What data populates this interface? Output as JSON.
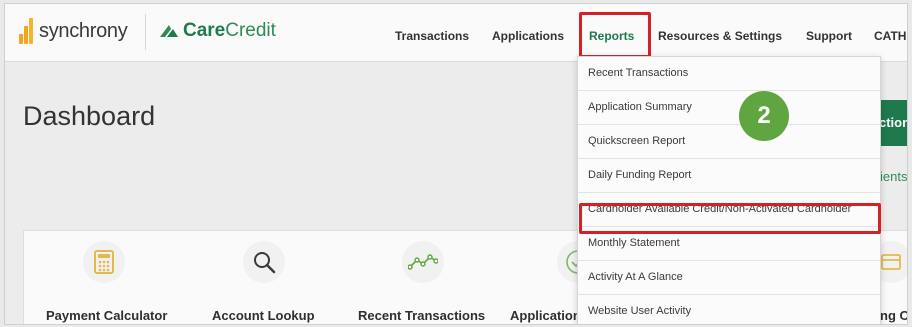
{
  "brand": {
    "synchrony": "synchrony",
    "care_prefix": "Care",
    "care_suffix": "Credit"
  },
  "nav": {
    "items": [
      {
        "label": "Transactions"
      },
      {
        "label": "Applications"
      },
      {
        "label": "Reports"
      },
      {
        "label": "Resources & Settings"
      },
      {
        "label": "Support"
      },
      {
        "label": "CATH"
      }
    ],
    "active": "Reports"
  },
  "page": {
    "title": "Dashboard",
    "right_button_partial": "ction",
    "right_link_partial": "ients"
  },
  "reports_menu": {
    "items": [
      {
        "label": "Recent Transactions"
      },
      {
        "label": "Application Summary"
      },
      {
        "label": "Quickscreen Report"
      },
      {
        "label": "Daily Funding Report"
      },
      {
        "label": "Cardholder Available Credit/Non-Activated Cardholder"
      },
      {
        "label": "Monthly Statement"
      },
      {
        "label": "Activity At A Glance"
      },
      {
        "label": "Website User Activity"
      }
    ],
    "highlighted": "Cardholder Available Credit/Non-Activated Cardholder"
  },
  "step_badge": "2",
  "tiles": [
    {
      "label": "Payment Calculator",
      "icon": "calculator-icon"
    },
    {
      "label": "Account Lookup",
      "icon": "search-icon"
    },
    {
      "label": "Recent Transactions",
      "icon": "trend-line-icon"
    },
    {
      "label": "Application",
      "icon": "check-circle-icon"
    },
    {
      "label": "ng C",
      "icon": "card-icon"
    }
  ],
  "colors": {
    "brand_green": "#1e7a4d",
    "highlight_red": "#d62028",
    "badge_green": "#5fa640"
  }
}
